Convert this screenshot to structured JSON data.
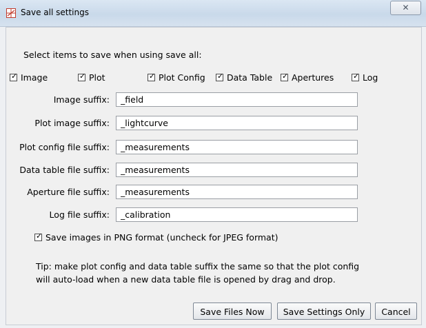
{
  "window": {
    "title": "Save all settings",
    "close_label": "✕"
  },
  "dialog": {
    "heading": "Select items to save when using save all:",
    "items": [
      {
        "label": "Image",
        "checked": true
      },
      {
        "label": "Plot",
        "checked": true
      },
      {
        "label": "Plot Config",
        "checked": true
      },
      {
        "label": "Data Table",
        "checked": true
      },
      {
        "label": "Apertures",
        "checked": true
      },
      {
        "label": "Log",
        "checked": true
      }
    ],
    "fields": [
      {
        "label": "Image suffix:",
        "value": "_field"
      },
      {
        "label": "Plot image suffix:",
        "value": "_lightcurve"
      },
      {
        "label": "Plot config file suffix:",
        "value": "_measurements"
      },
      {
        "label": "Data table file suffix:",
        "value": "_measurements"
      },
      {
        "label": "Aperture file suffix:",
        "value": "_measurements"
      },
      {
        "label": "Log file suffix:",
        "value": "_calibration"
      }
    ],
    "png_option": {
      "label": "Save images in PNG format (uncheck for JPEG format)",
      "checked": true
    },
    "tip_line1": "Tip: make plot config and data table suffix the same so that the plot config",
    "tip_line2": "will auto-load when a new data table file is opened by drag and drop.",
    "buttons": {
      "save_files_now": "Save Files Now",
      "save_settings_only": "Save Settings Only",
      "cancel": "Cancel"
    }
  },
  "icons": {
    "app": "grid-plot-icon",
    "close": "close-icon",
    "check": "checkmark-icon"
  },
  "colors": {
    "titlebar": "#c9d9ea",
    "app_icon": "#c0392b",
    "dialog_bg": "#f0f0f0"
  }
}
